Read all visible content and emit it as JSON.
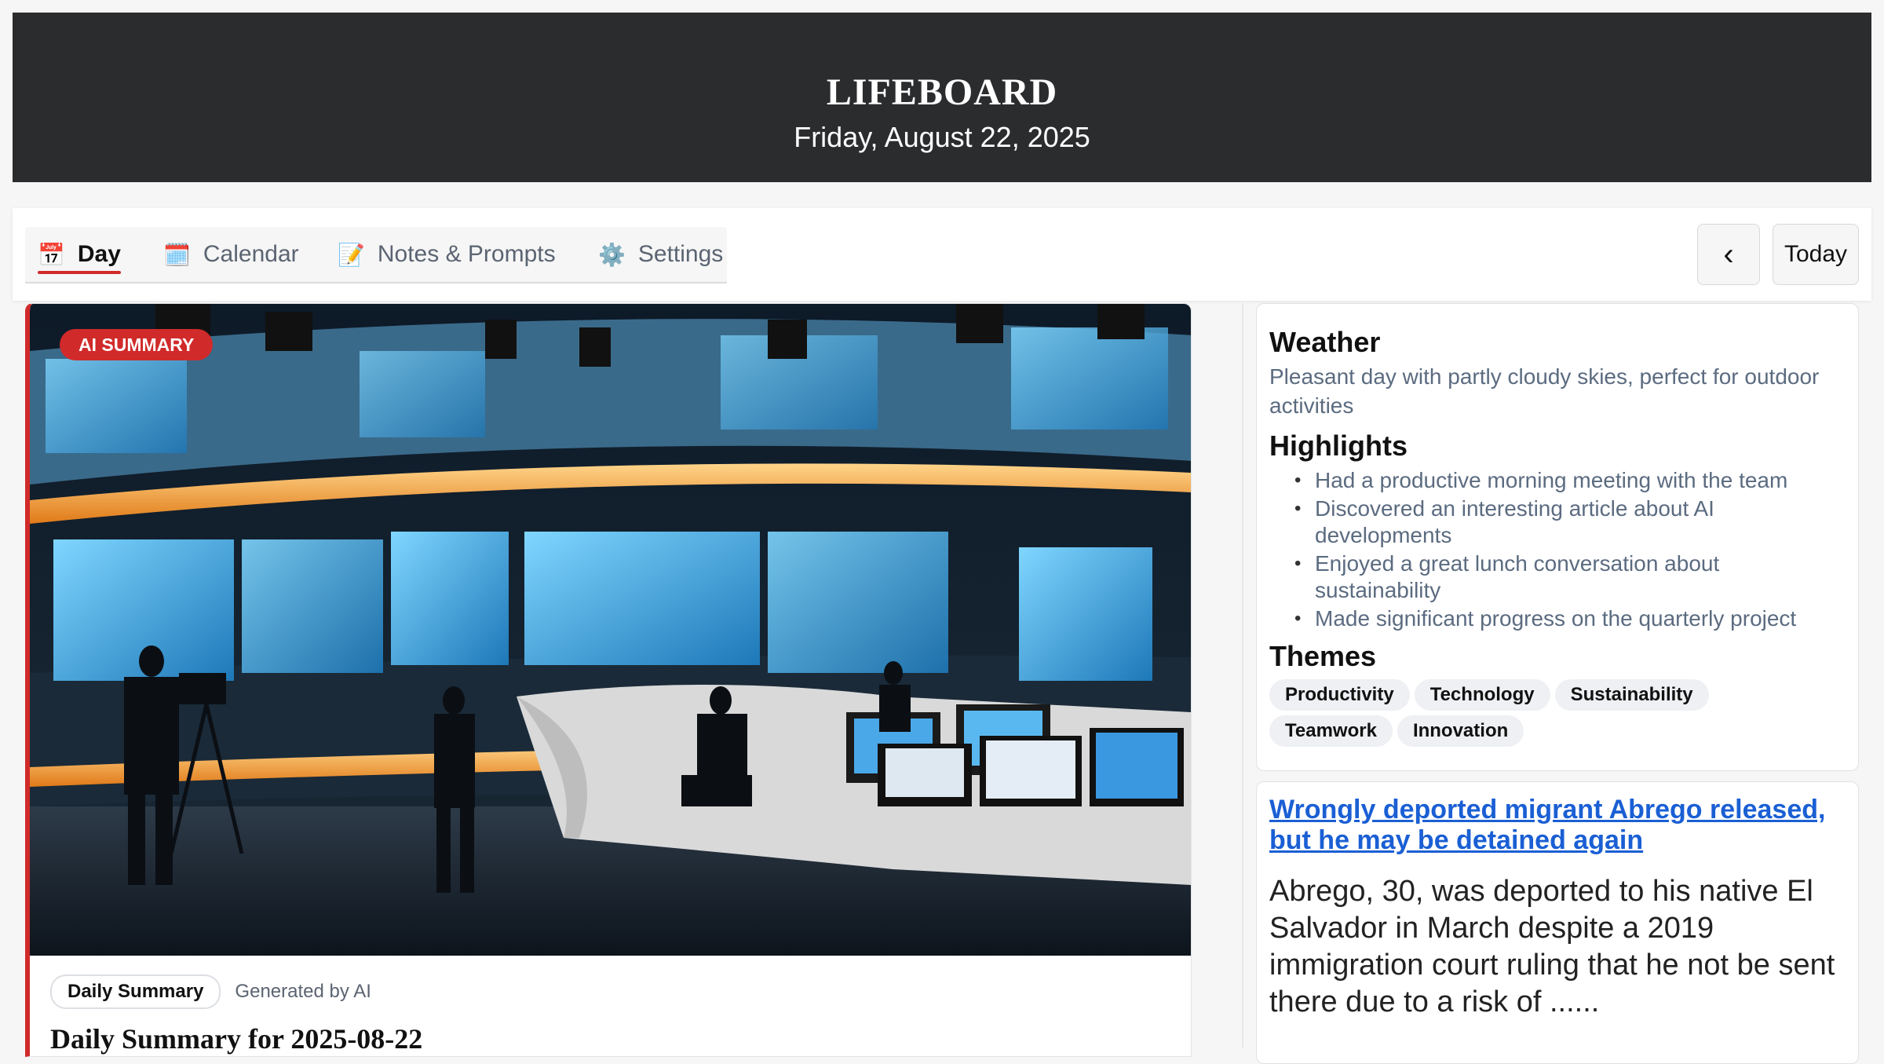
{
  "header": {
    "title": "LIFEBOARD",
    "date": "Friday, August 22, 2025"
  },
  "tabs": [
    {
      "label": "Day",
      "icon": "calendar-icon",
      "active": true
    },
    {
      "label": "Calendar",
      "icon": "calendar-icon",
      "active": false
    },
    {
      "label": "Notes & Prompts",
      "icon": "memo-icon",
      "active": false
    },
    {
      "label": "Settings",
      "icon": "gear-icon",
      "active": false
    }
  ],
  "nav": {
    "prev_label": "‹",
    "today_label": "Today"
  },
  "hero": {
    "badge": "AI SUMMARY",
    "chip": "Daily Summary",
    "generated": "Generated by AI",
    "title": "Daily Summary for 2025-08-22",
    "image_icon": "newsroom-image"
  },
  "summary": {
    "weather_heading": "Weather",
    "weather_text": "Pleasant day with partly cloudy skies, perfect for outdoor activities",
    "highlights_heading": "Highlights",
    "highlights": [
      "Had a productive morning meeting with the team",
      "Discovered an interesting article about AI developments",
      "Enjoyed a great lunch conversation about sustainability",
      "Made significant progress on the quarterly project"
    ],
    "themes_heading": "Themes",
    "themes": [
      "Productivity",
      "Technology",
      "Sustainability",
      "Teamwork",
      "Innovation"
    ]
  },
  "news": {
    "headline": "Wrongly deported migrant Abrego released, but he may be detained again",
    "body": "Abrego, 30, was deported to his native El Salvador in March despite a 2019 immigration court ruling that he not be sent there due to a risk of ......"
  },
  "colors": {
    "accent": "#d12a2a",
    "header_bg": "#2b2c2e",
    "link": "#1a5fd4"
  }
}
